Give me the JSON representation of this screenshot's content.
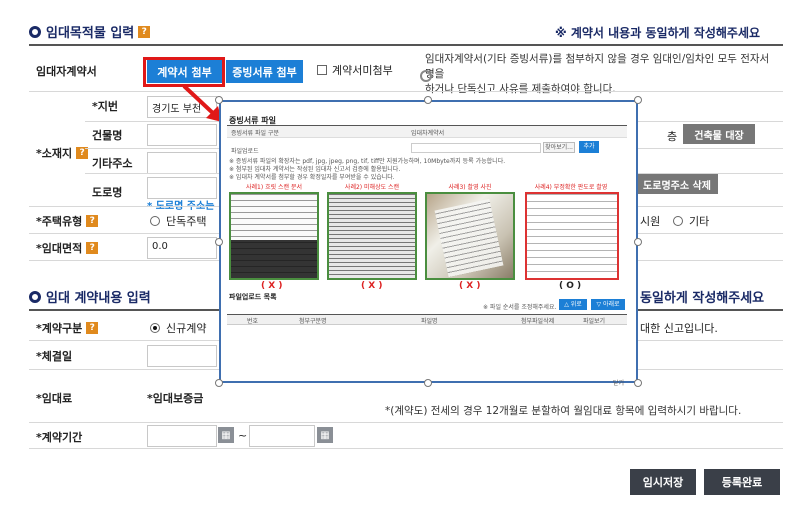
{
  "section1": {
    "title": "임대목적물 입력",
    "notice": "※ 계약서 내용과 동일하게 작성해주세요"
  },
  "contract_attach": {
    "label": "임대자계약서",
    "attach_button": "계약서 첨부",
    "proof_button": "증빙서류 첨부",
    "no_attach_label": "계약서미첨부",
    "info_line1": "임대자계약서(기타 증빙서류)를 첨부하지 않을 경우 임대인/임차인 모두 전자서명을",
    "info_line2": "하거나 단독신고 사유를 제출하여야 합니다."
  },
  "location": {
    "group_label": "*소재지",
    "lot_label": "*지번",
    "lot_value": "경기도 부천",
    "building_label": "건물명",
    "floor_suffix": "층",
    "building_ledger_button": "건축물 대장",
    "other_addr_label": "기타주소",
    "road_label": "도로명",
    "road_delete_button": "도로명주소 삭제",
    "road_note": "* 도로명 주소는"
  },
  "housing_type": {
    "label": "*주택유형",
    "option_detached": "단독주택",
    "option_officetel": "시원",
    "option_other": "기타"
  },
  "lease_area": {
    "label": "*임대면적",
    "value": "0.0"
  },
  "section2": {
    "title": "임대 계약내용 입력",
    "notice": "동일하게 작성해주세요"
  },
  "contract_type": {
    "label": "*계약구분",
    "option_new": "신규계약",
    "note": "대한 신고입니다."
  },
  "sign_date": {
    "label": "*체결일"
  },
  "rent": {
    "label": "*임대료",
    "deposit_label": "*임대보증금",
    "note": "*(계약도) 전세의 경우 12개월로 분할하여 월임대료 항목에 입력하시기 바랍니다."
  },
  "period": {
    "label": "*계약기간",
    "separator": "~"
  },
  "footer": {
    "save_button": "임시저장",
    "register_button": "등록완료"
  },
  "popup": {
    "title": "증빙서류 파일",
    "type_label": "증빙서류 파일 구분",
    "type_value": "임대차계약서",
    "upload_label": "파일업로드",
    "browse_button": "찾아보기...",
    "add_button": "추가",
    "guide1": "※ 증빙서류 파일의 확장자는 pdf, jpg, jpeg, png, tif, tiff만 지원가능하며, 10Mbyte까지 등록 가능합니다.",
    "guide2": "※ 첨부된 임대차 계약서는 작성된 임대차 신고서 검증에 활용됩니다.",
    "guide3": "※ 임대차 계약서를 첨부할 경우 확정일자를 부여받을 수 있습니다.",
    "samples": [
      {
        "caption": "사례1) 흐릿 스캔 문서",
        "mark": "( X )"
      },
      {
        "caption": "사례2) 미해상도 스캔",
        "mark": "( X )"
      },
      {
        "caption": "사례3) 촬영 사진",
        "mark": "( X )"
      },
      {
        "caption": "사례4) 부정확한 판도로 촬영",
        "mark": "( O )"
      }
    ],
    "list_title": "파일업로드 목록",
    "sort_note": "※ 파일 순서를 조정해주세요.",
    "up_button": "△ 위로",
    "down_button": "▽ 아래로",
    "columns": [
      "번호",
      "첨부구분명",
      "파일명",
      "첨부파일삭제",
      "파일보기"
    ],
    "close_label": "닫기"
  },
  "colors": {
    "accent": "#1c7fd6",
    "highlight": "#e01818",
    "title": "#1a2a66"
  }
}
